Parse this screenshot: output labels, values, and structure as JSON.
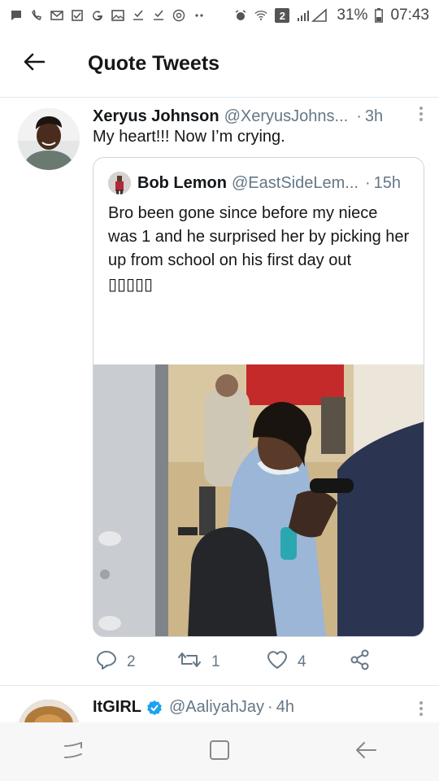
{
  "status_bar": {
    "left_icons": [
      "chat-icon",
      "missed-call-icon",
      "gmail-icon",
      "checkbox-icon",
      "google-icon",
      "gallery-icon",
      "download-icon",
      "download-icon",
      "camera-icon",
      "more-dots-icon"
    ],
    "right_icons": [
      "alarm-icon",
      "wifi-icon",
      "sim-icon",
      "signal-icon",
      "battery-icon"
    ],
    "sim_number": "2",
    "battery": "31%",
    "time": "07:43"
  },
  "header": {
    "title": "Quote Tweets",
    "back_icon": "arrow-left-icon"
  },
  "tweet": {
    "name": "Xeryus Johnson",
    "handle": "@XeryusJohns...",
    "dot": "·",
    "time": "3h",
    "text": "My heart!!! Now I’m crying.",
    "quoted": {
      "name": "Bob Lemon",
      "handle": "@EastSideLem...",
      "dot": "·",
      "time": "15h",
      "text": "Bro been gone since before my niece was 1 and he surprised her by picking her up from school on his first day out",
      "emoji": "▯▯▯▯▯"
    },
    "actions": {
      "replies": "2",
      "retweets": "1",
      "likes": "4"
    }
  },
  "next_tweet": {
    "name": "ItGIRL",
    "handle": "@AaliyahJay",
    "dot": "·",
    "time": "4h"
  },
  "colors": {
    "text": "#14171a",
    "secondary": "#657786",
    "border": "#e1e8ed",
    "verified": "#1da1f2"
  }
}
